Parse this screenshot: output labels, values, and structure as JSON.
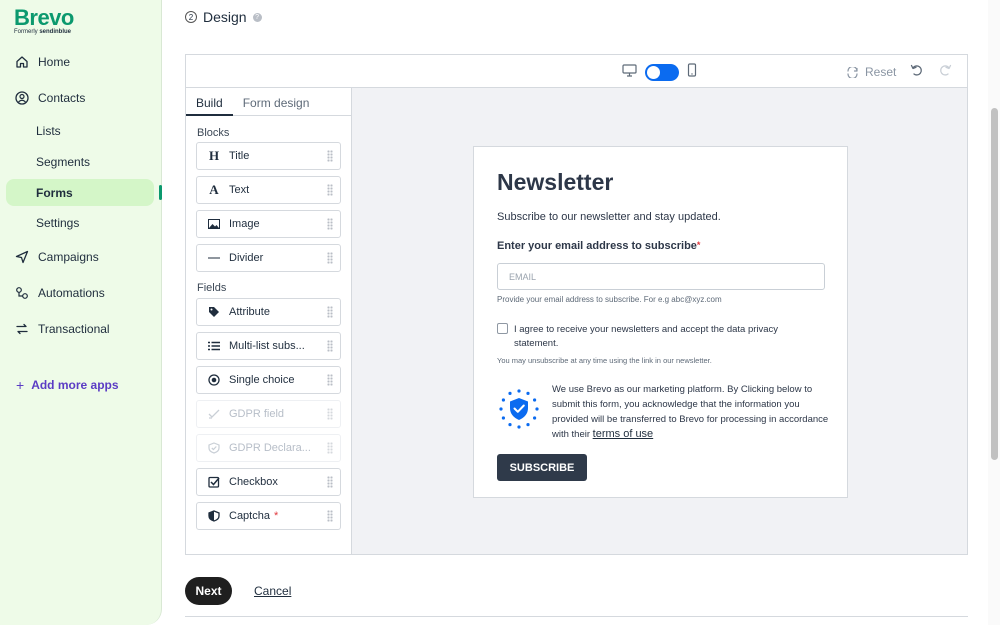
{
  "brand": {
    "name": "Brevo",
    "formerly_label": "Formerly",
    "formerly_name": "sendinblue",
    "color": "#0b996e"
  },
  "sidebar": {
    "items": [
      {
        "label": "Home",
        "icon": "home-icon"
      },
      {
        "label": "Contacts",
        "icon": "contacts-icon"
      },
      {
        "label": "Lists"
      },
      {
        "label": "Segments"
      },
      {
        "label": "Forms",
        "active": true
      },
      {
        "label": "Settings"
      },
      {
        "label": "Campaigns",
        "icon": "send-icon"
      },
      {
        "label": "Automations",
        "icon": "automation-icon"
      },
      {
        "label": "Transactional",
        "icon": "transactional-icon"
      }
    ],
    "add_apps": "Add more apps"
  },
  "header": {
    "step_number": "2",
    "title": "Design"
  },
  "toolbar": {
    "reset_label": "Reset"
  },
  "panel": {
    "tabs": [
      "Build",
      "Form design"
    ],
    "blocks_label": "Blocks",
    "fields_label": "Fields",
    "blocks": [
      {
        "label": "Title",
        "icon": "H"
      },
      {
        "label": "Text",
        "icon": "A"
      },
      {
        "label": "Image",
        "icon": "image-icon"
      },
      {
        "label": "Divider",
        "icon": "divider-icon"
      }
    ],
    "fields": [
      {
        "label": "Attribute",
        "icon": "tag-icon"
      },
      {
        "label": "Multi-list subs...",
        "icon": "list-icon"
      },
      {
        "label": "Single choice",
        "icon": "radio-icon"
      },
      {
        "label": "GDPR field",
        "icon": "gdpr-check-icon",
        "disabled": true
      },
      {
        "label": "GDPR Declara...",
        "icon": "shield-check-icon",
        "disabled": true
      },
      {
        "label": "Checkbox",
        "icon": "checkbox-icon"
      },
      {
        "label": "Captcha",
        "icon": "shield-icon",
        "required": "*"
      }
    ]
  },
  "form": {
    "title": "Newsletter",
    "subtitle": "Subscribe to our newsletter and stay updated.",
    "email_label": "Enter your email address to subscribe",
    "required_mark": "*",
    "email_placeholder": "EMAIL",
    "email_help": "Provide your email address to subscribe. For e.g abc@xyz.com",
    "consent": "I agree to receive your newsletters and accept the data privacy statement.",
    "unsubscribe": "You may unsubscribe at any time using the link in our newsletter.",
    "brevo_notice": "We use Brevo as our marketing platform. By Clicking below to submit this form, you acknowledge that the information you provided will be transferred to Brevo for processing in accordance with their ",
    "terms": "terms of use",
    "button": "SUBSCRIBE"
  },
  "footer": {
    "next": "Next",
    "cancel": "Cancel"
  },
  "colors": {
    "accent": "#0b6bf0",
    "sidebar_bg": "#eefbe8",
    "active_bg": "#d4f6c8",
    "add_apps": "#5b3cc4",
    "button_dark": "#2f3a4a"
  }
}
